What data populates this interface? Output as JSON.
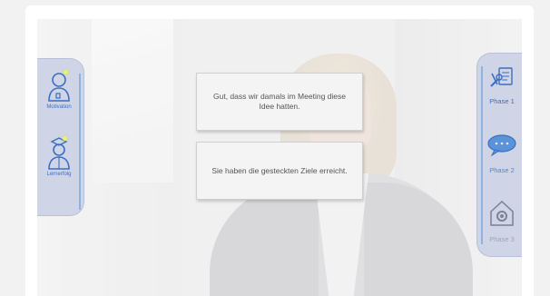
{
  "scene": {
    "bubbles": [
      "Gut, dass wir damals im Meeting diese Idee hatten.",
      "Sie haben die gesteckten Ziele erreicht."
    ]
  },
  "left_panel": {
    "items": [
      {
        "label": "Motivation",
        "icon": "person-icon"
      },
      {
        "label": "Lernerfolg",
        "icon": "graduate-icon"
      }
    ]
  },
  "right_panel": {
    "items": [
      {
        "label": "Phase 1",
        "icon": "tools-icon"
      },
      {
        "label": "Phase 2",
        "icon": "speech-bubble-icon"
      },
      {
        "label": "Phase 3",
        "icon": "house-gear-icon"
      }
    ]
  },
  "colors": {
    "accent": "#3c6fbf",
    "panel": "#cfd5e6",
    "indicator": "#e5f56a"
  }
}
